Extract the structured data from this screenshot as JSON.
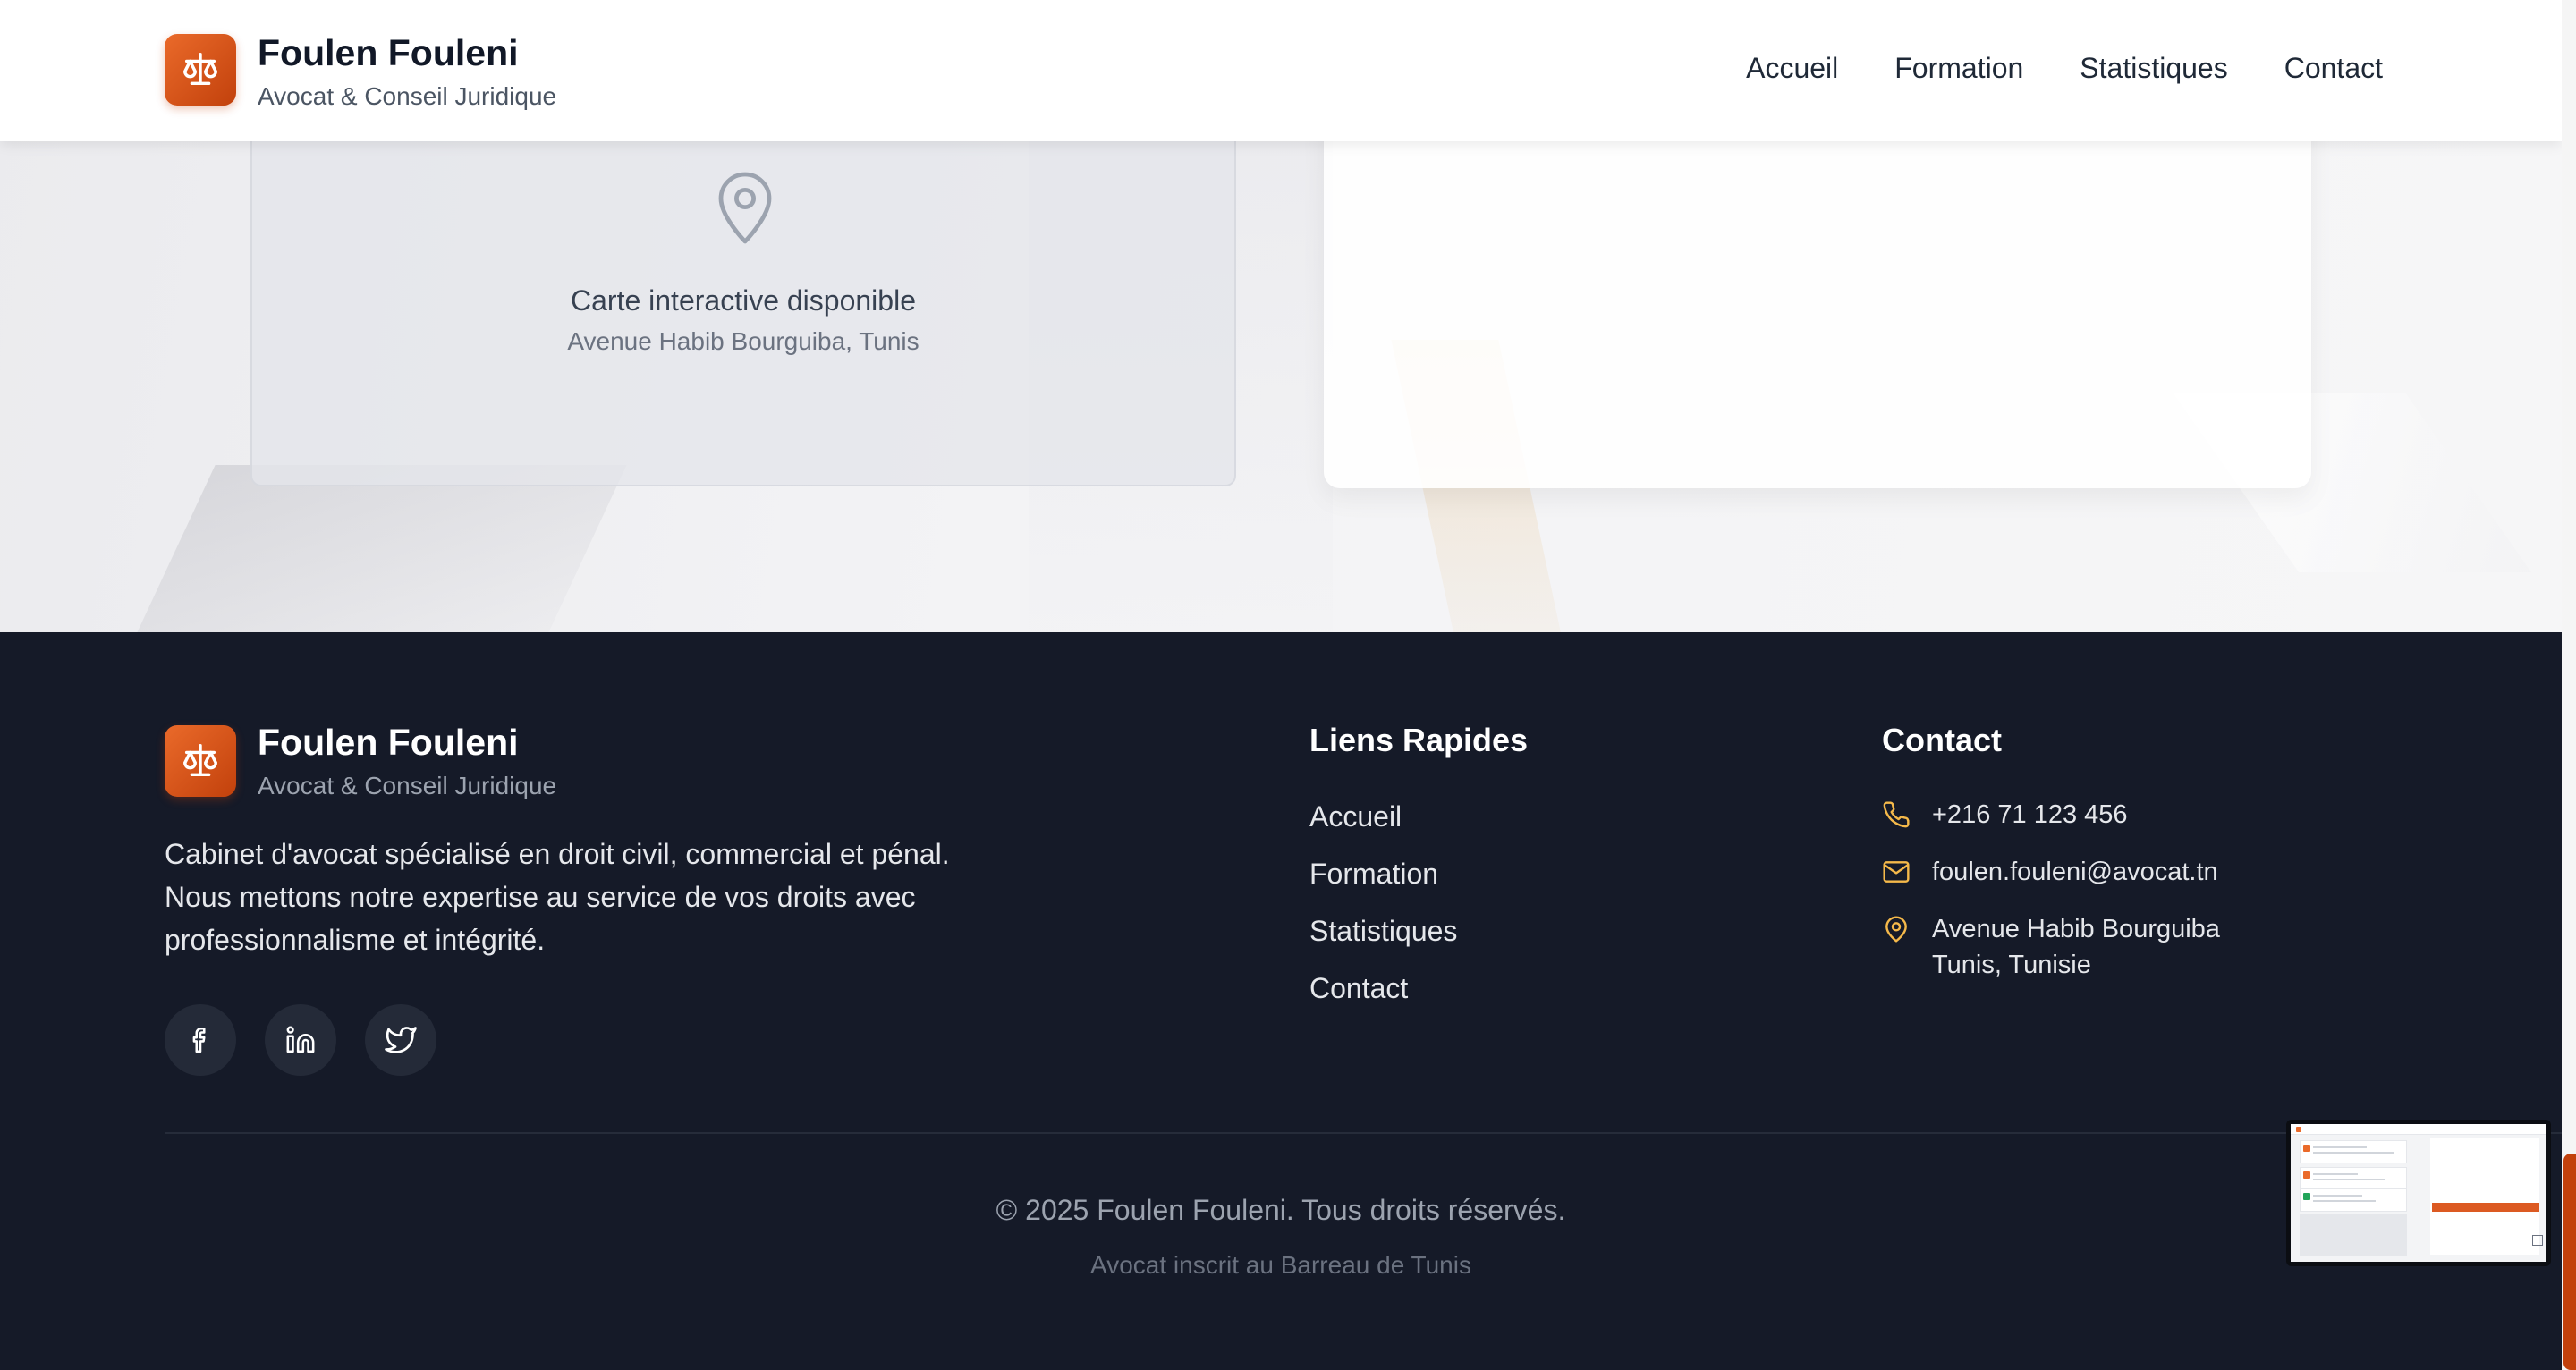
{
  "header": {
    "brand_name": "Foulen Fouleni",
    "brand_tagline": "Avocat & Conseil Juridique",
    "nav": [
      "Accueil",
      "Formation",
      "Statistiques",
      "Contact"
    ]
  },
  "map": {
    "title": "Carte interactive disponible",
    "address": "Avenue Habib Bourguiba, Tunis"
  },
  "footer": {
    "brand_name": "Foulen Fouleni",
    "brand_tagline": "Avocat & Conseil Juridique",
    "description": "Cabinet d'avocat spécialisé en droit civil, commercial et pénal. Nous mettons notre expertise au service de vos droits avec professionnalisme et intégrité.",
    "social": [
      "facebook-icon",
      "linkedin-icon",
      "twitter-icon"
    ],
    "quick_links_title": "Liens Rapides",
    "quick_links": [
      "Accueil",
      "Formation",
      "Statistiques",
      "Contact"
    ],
    "contact_title": "Contact",
    "phone": "+216 71 123 456",
    "email": "foulen.fouleni@avocat.tn",
    "address_line1": "Avenue Habib Bourguiba",
    "address_line2": "Tunis, Tunisie",
    "copyright": "© 2025 Foulen Fouleni. Tous droits réservés.",
    "registration": "Avocat inscrit au Barreau de Tunis"
  },
  "colors": {
    "accent": "#ea6a2a",
    "accent_dark": "#c2410c",
    "contact_icon": "#f5b94a",
    "footer_bg": "#151a28"
  }
}
